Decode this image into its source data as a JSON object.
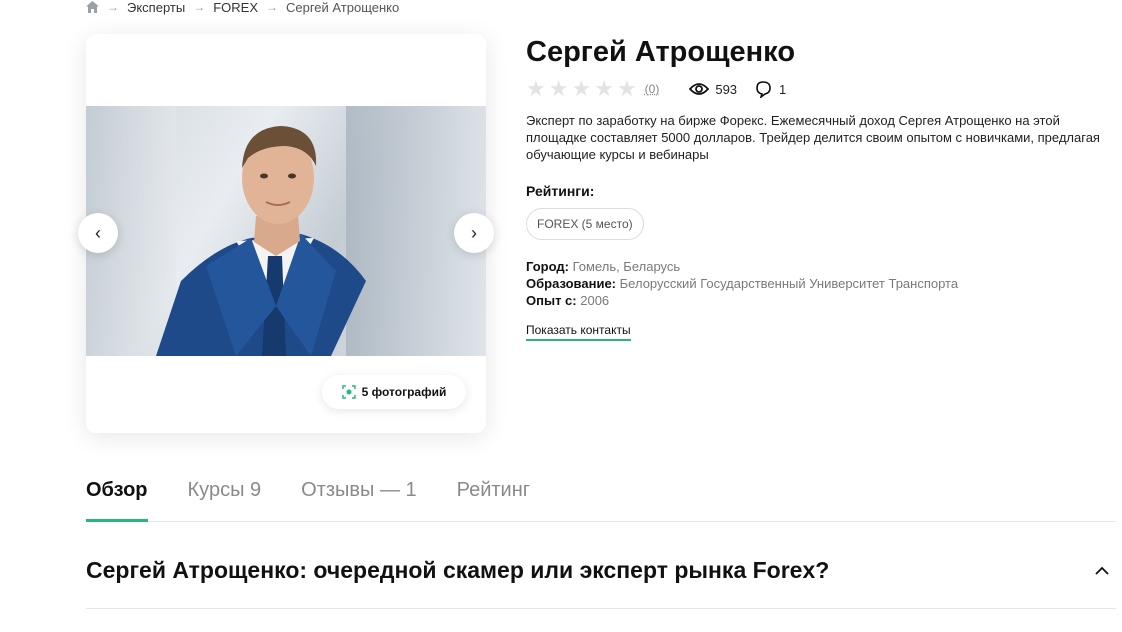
{
  "breadcrumb": {
    "items": [
      "Эксперты",
      "FOREX"
    ],
    "current": "Сергей Атрощенко"
  },
  "gallery": {
    "photos_label": "5 фотографий"
  },
  "profile": {
    "name": "Сергей Атрощенко",
    "rating_count": "(0)",
    "views": "593",
    "comments": "1",
    "description": "Эксперт по заработку на бирже Форекс. Ежемесячный доход Сергея Атрощенко на этой площадке составляет 5000 долларов. Трейдер делится своим опытом с новичками, предлагая обучающие курсы и вебинары",
    "ratings_label": "Рейтинги:",
    "rating_chip": "FOREX (5 место)",
    "city_label": "Город:",
    "city": "Гомель, Беларусь",
    "education_label": "Образование:",
    "education": "Белорусский Государственный Университет Транспорта",
    "experience_label": "Опыт с:",
    "experience": "2006",
    "show_contacts": "Показать контакты"
  },
  "tabs": [
    {
      "label": "Обзор"
    },
    {
      "label": "Курсы 9"
    },
    {
      "label": "Отзывы — 1"
    },
    {
      "label": "Рейтинг"
    }
  ],
  "section": {
    "title": "Сергей Атрощенко: очередной скамер или эксперт рынка Forex?"
  },
  "colors": {
    "accent": "#2ab57d",
    "star_empty": "#e3e3e3",
    "suit": "#1f4a8a"
  }
}
